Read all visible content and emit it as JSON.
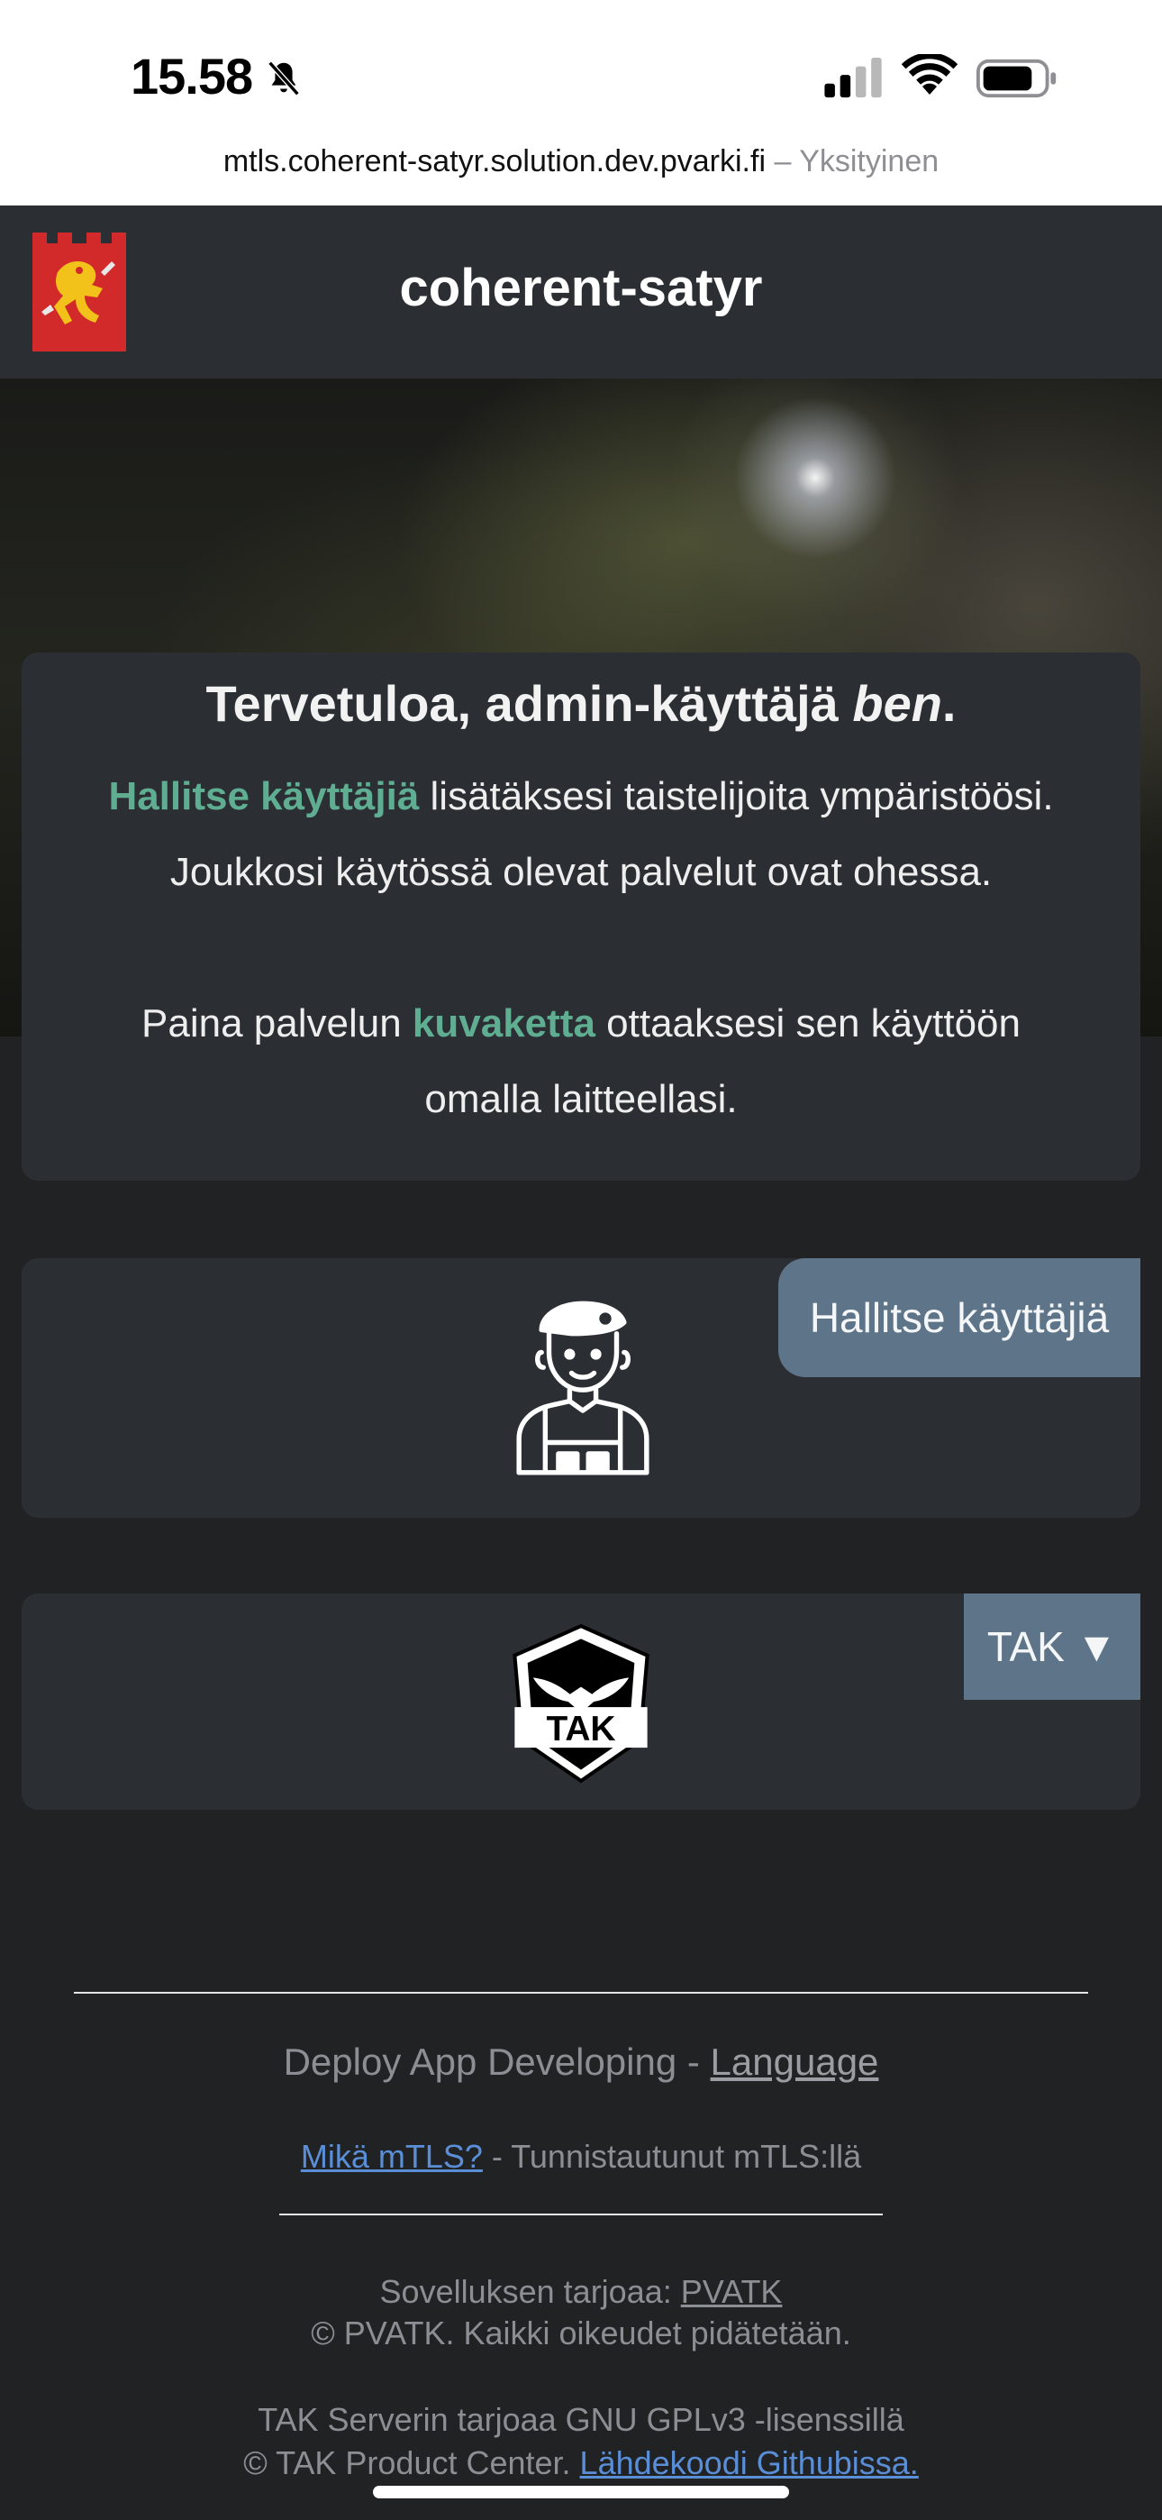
{
  "status_bar": {
    "time": "15.58",
    "url": "mtls.coherent-satyr.solution.dev.pvarki.fi",
    "separator": " – ",
    "private_label": "Yksityinen",
    "icons": [
      "bell-slash-icon",
      "cellular-signal-icon",
      "wifi-icon",
      "battery-icon"
    ]
  },
  "header": {
    "title": "coherent-satyr",
    "logo": "lion-coat-of-arms-icon"
  },
  "welcome": {
    "title_prefix": "Tervetuloa, admin-käyttäjä ",
    "title_name": "ben",
    "title_suffix": ".",
    "line1_link": "Hallitse käyttäjiä",
    "line1_rest": " lisätäksesi taistelijoita ympäristöösi.",
    "line2": "Joukkosi käytössä olevat palvelut ovat ohessa.",
    "line3_prefix": "Paina palvelun ",
    "line3_link": "kuvaketta",
    "line3_suffix": " ottaaksesi sen käyttöön",
    "line4": "omalla laitteellasi."
  },
  "services": {
    "manage_users_label": "Hallitse käyttäjiä",
    "tak_label": "TAK ▼",
    "tak_logo_text": "TAK"
  },
  "footer": {
    "deploy_text": "Deploy App Developing - ",
    "language_link": "Language",
    "mtls_link": "Mikä mTLS?",
    "mtls_text": " - Tunnistautunut mTLS:llä",
    "provider_text": "Sovelluksen tarjoaa: ",
    "provider_link": "PVATK",
    "copyright": "© PVATK. Kaikki oikeudet pidätetään.",
    "tak_license": "TAK Serverin tarjoaa GNU GPLv3 -lisenssillä",
    "tak_copyright": "© TAK Product Center. ",
    "source_link": "Lähdekoodi Githubissa."
  },
  "colors": {
    "accent_green": "#5fae92",
    "button_blue": "#5d7489",
    "card_bg": "#2b2e33",
    "page_bg": "#212224",
    "link_blue": "#5a8fd8"
  }
}
